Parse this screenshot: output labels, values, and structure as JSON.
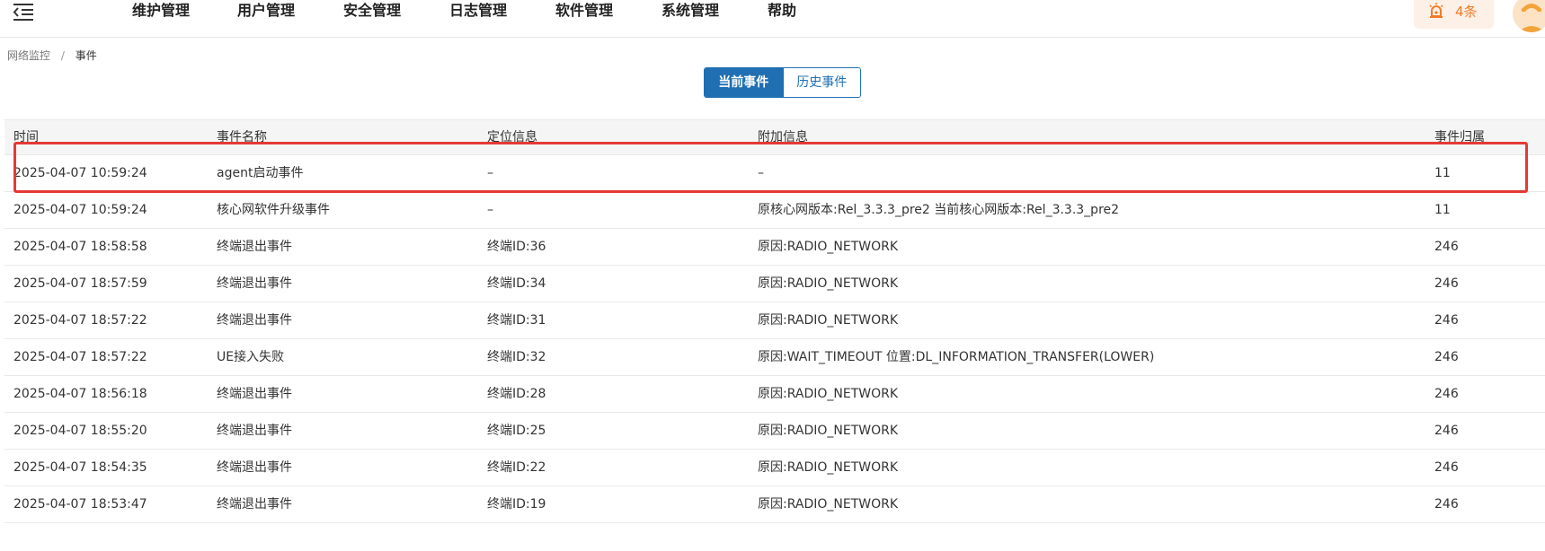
{
  "nav": {
    "items": [
      "维护管理",
      "用户管理",
      "安全管理",
      "日志管理",
      "软件管理",
      "系统管理",
      "帮助"
    ]
  },
  "alarm": {
    "count_label": "4条",
    "icon": "alarm-icon"
  },
  "breadcrumb": {
    "parent": "网络监控",
    "separator": "/",
    "current": "事件"
  },
  "tabs": {
    "current": "当前事件",
    "history": "历史事件",
    "selected": "current"
  },
  "table": {
    "columns": [
      "时间",
      "事件名称",
      "定位信息",
      "附加信息",
      "事件归属"
    ],
    "rows": [
      [
        "2025-04-07 10:59:24",
        "agent启动事件",
        "–",
        "–",
        "11"
      ],
      [
        "2025-04-07 10:59:24",
        "核心网软件升级事件",
        "–",
        "原核心网版本:Rel_3.3.3_pre2 当前核心网版本:Rel_3.3.3_pre2",
        "11"
      ],
      [
        "2025-04-07 18:58:58",
        "终端退出事件",
        "终端ID:36",
        "原因:RADIO_NETWORK",
        "246"
      ],
      [
        "2025-04-07 18:57:59",
        "终端退出事件",
        "终端ID:34",
        "原因:RADIO_NETWORK",
        "246"
      ],
      [
        "2025-04-07 18:57:22",
        "终端退出事件",
        "终端ID:31",
        "原因:RADIO_NETWORK",
        "246"
      ],
      [
        "2025-04-07 18:57:22",
        "UE接入失败",
        "终端ID:32",
        "原因:WAIT_TIMEOUT 位置:DL_INFORMATION_TRANSFER(LOWER)",
        "246"
      ],
      [
        "2025-04-07 18:56:18",
        "终端退出事件",
        "终端ID:28",
        "原因:RADIO_NETWORK",
        "246"
      ],
      [
        "2025-04-07 18:55:20",
        "终端退出事件",
        "终端ID:25",
        "原因:RADIO_NETWORK",
        "246"
      ],
      [
        "2025-04-07 18:54:35",
        "终端退出事件",
        "终端ID:22",
        "原因:RADIO_NETWORK",
        "246"
      ],
      [
        "2025-04-07 18:53:47",
        "终端退出事件",
        "终端ID:19",
        "原因:RADIO_NETWORK",
        "246"
      ]
    ]
  },
  "colors": {
    "accent": "#1f6fb2",
    "alarm": "#f07c2a",
    "highlight": "#e53935"
  }
}
